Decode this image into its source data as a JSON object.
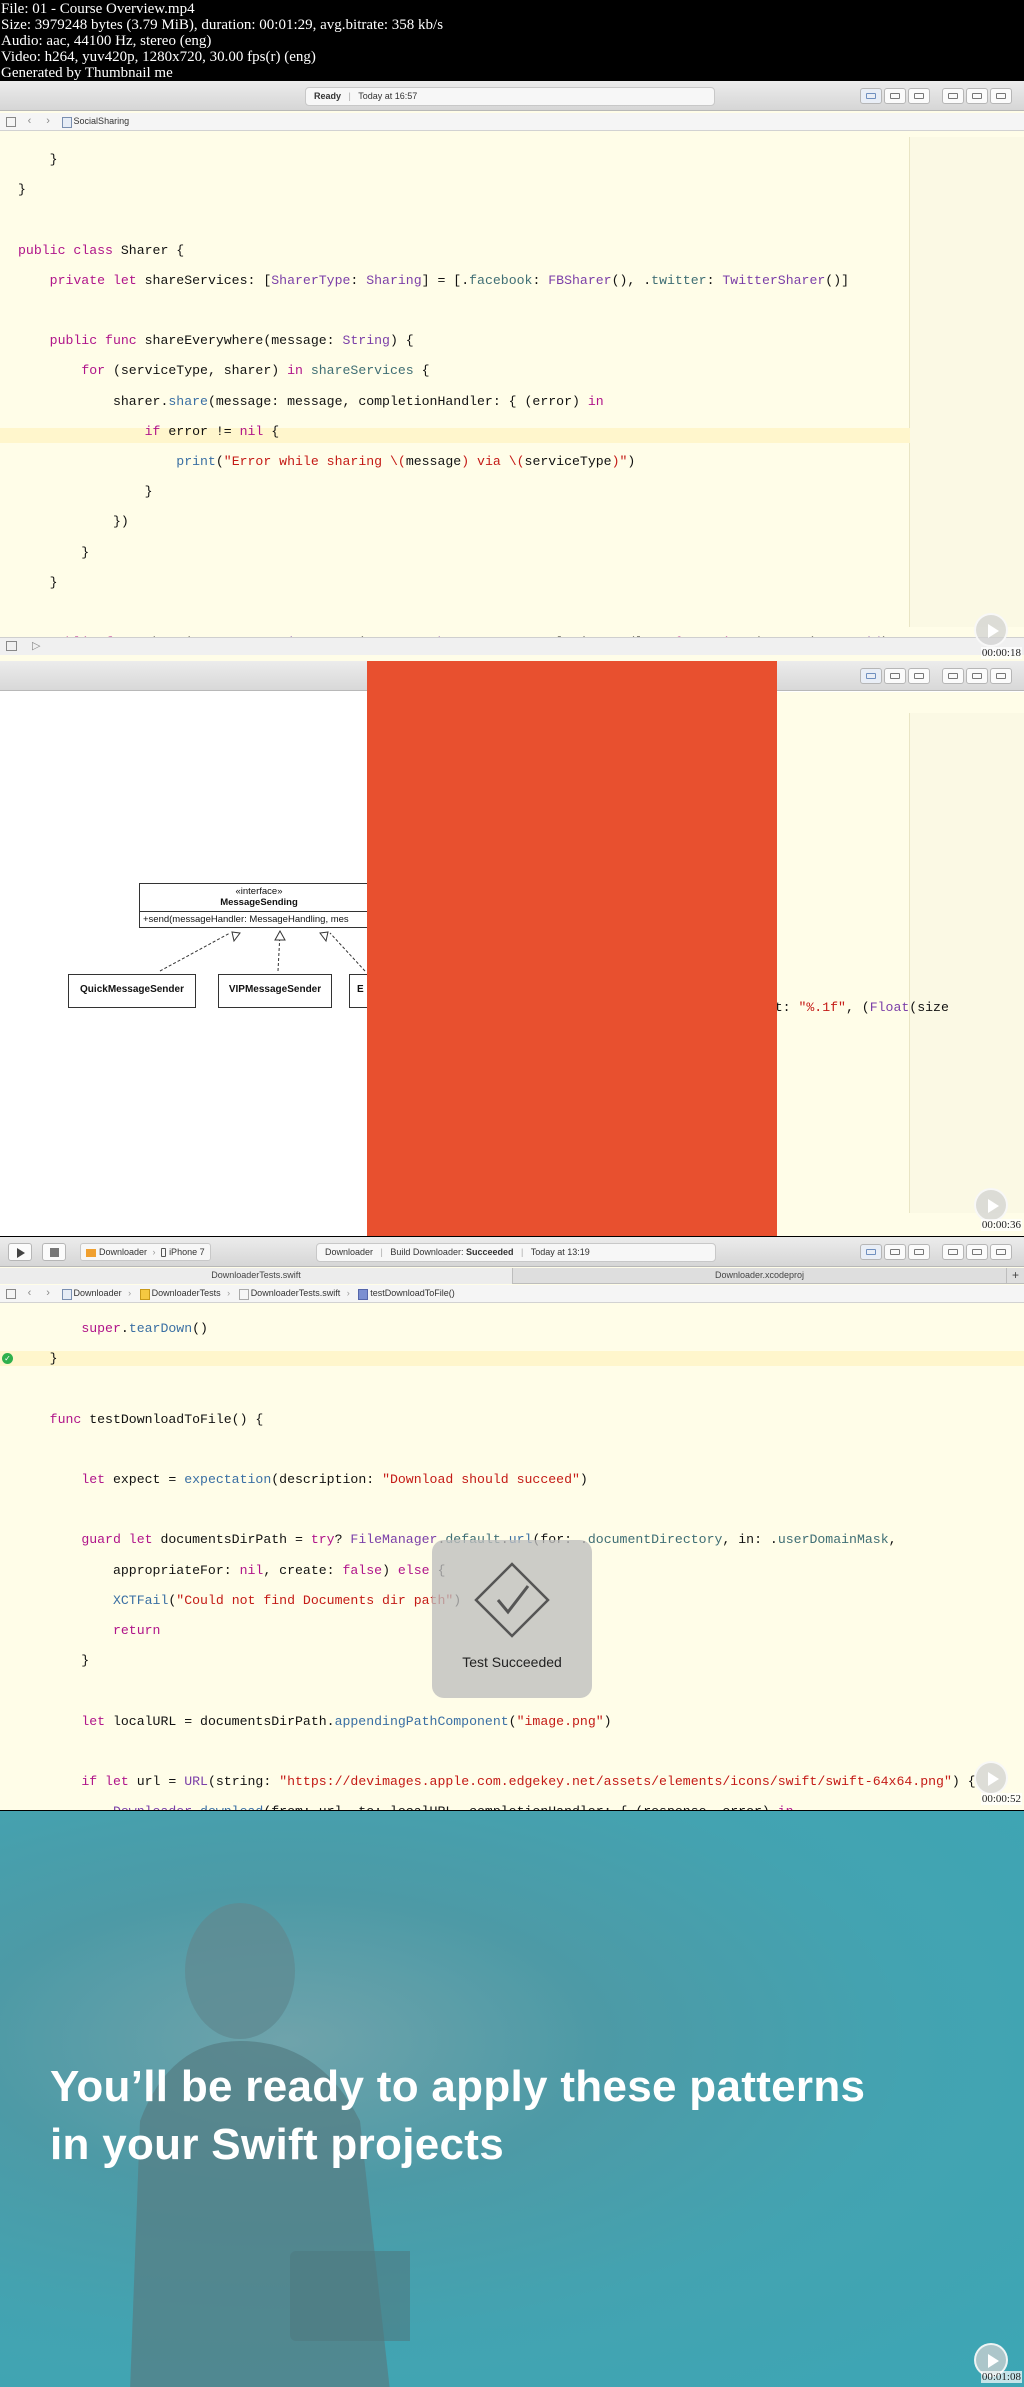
{
  "meta": {
    "lines": [
      "File: 01 - Course Overview.mp4",
      "Size: 3979248 bytes (3.79 MiB), duration: 00:01:29, avg.bitrate: 358 kb/s",
      "Audio: aac, 44100 Hz, stereo (eng)",
      "Video: h264, yuv420p, 1280x720, 30.00 fps(r) (eng)",
      "Generated by Thumbnail me"
    ]
  },
  "frame1": {
    "status_state": "Ready",
    "status_time": "Today at 16:57",
    "breadcrumb": "SocialSharing",
    "timestamp": "00:00:18"
  },
  "frame2": {
    "uml": {
      "stereotype": "«interface»",
      "name": "MessageSending",
      "method": "+send(messageHandler: MessageHandling, mes",
      "leaves": [
        "QuickMessageSender",
        "VIPMessageSender",
        "E"
      ]
    },
    "code_fragment_pre": "rmat: ",
    "code_fragment_str": "\"%.1f\"",
    "code_fragment_post": ", (",
    "code_fragment_ty": "Float",
    "code_fragment_end": "(size",
    "timestamp": "00:00:36"
  },
  "frame3": {
    "scheme": "Downloader",
    "device": "iPhone 7",
    "status_target": "Downloader",
    "status_build": "Build Downloader:",
    "status_result": "Succeeded",
    "status_time": "Today at 13:19",
    "tabs": [
      "DownloaderTests.swift",
      "Downloader.xcodeproj"
    ],
    "breadcrumbs": [
      "Downloader",
      "DownloaderTests",
      "DownloaderTests.swift",
      "testDownloadToFile()"
    ],
    "hud_label": "Test Succeeded",
    "timestamp": "00:00:52"
  },
  "frame4": {
    "heading_line1": "You’ll be ready to apply these patterns",
    "heading_line2": "in your Swift projects",
    "timestamp": "00:01:08"
  },
  "colors": {
    "editor_bg": "#fffde8",
    "keyword": "#b0148a",
    "type": "#7b3fa8",
    "string": "#c41a16",
    "slide_teal": "#43a3b1",
    "red_panel": "#e8502f"
  }
}
